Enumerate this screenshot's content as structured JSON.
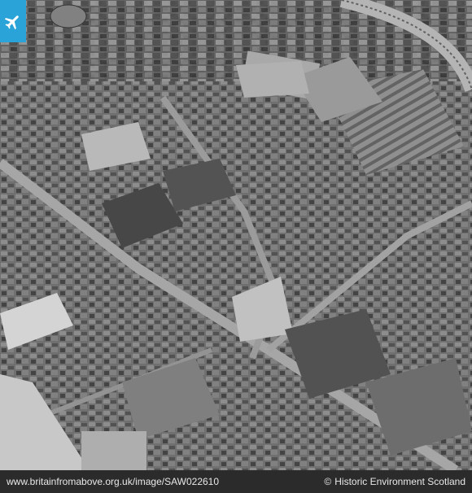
{
  "photo": {
    "icon": "airplane-icon",
    "badge_color": "#2aa3d8"
  },
  "footer": {
    "url": "www.britainfromabove.org.uk/image/SAW022610",
    "copyright_symbol": "©",
    "credit": "Historic Environment Scotland"
  }
}
